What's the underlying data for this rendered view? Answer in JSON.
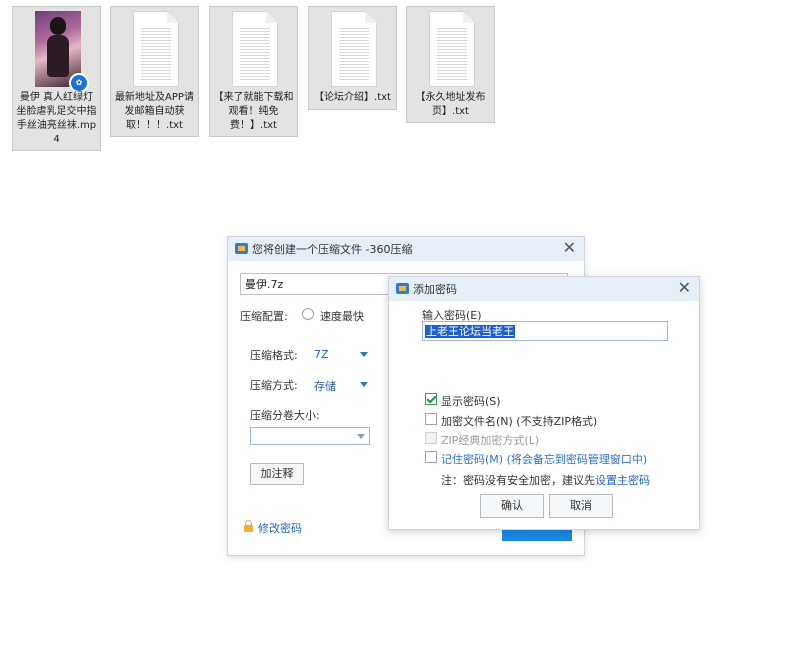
{
  "desktop": {
    "files": [
      {
        "name": "曼伊 真人红绿灯坐脸虐乳足交中指手丝油亮丝袜.mp4",
        "type": "video",
        "icon": "video-thumbnail"
      },
      {
        "name": "最新地址及APP请发邮箱自动获取！！！.txt",
        "type": "text",
        "icon": "text-file-icon"
      },
      {
        "name": "【来了就能下载和观看！纯免费！】.txt",
        "type": "text",
        "icon": "text-file-icon"
      },
      {
        "name": "【论坛介绍】.txt",
        "type": "text",
        "icon": "text-file-icon"
      },
      {
        "name": "【永久地址发布页】.txt",
        "type": "text",
        "icon": "text-file-icon"
      }
    ]
  },
  "create_dialog": {
    "title": "您将创建一个压缩文件 -360压缩",
    "filename": "曼伊.7z",
    "config_label": "压缩配置:",
    "config_option": "速度最快",
    "format_label": "压缩格式:",
    "format_value": "7Z",
    "method_label": "压缩方式:",
    "method_value": "存储",
    "split_label": "压缩分卷大小:",
    "split_value": "",
    "comment_button": "加注释",
    "change_password_link": "修改密码",
    "accent": "#1c88e6"
  },
  "password_dialog": {
    "title": "添加密码",
    "input_label": "输入密码(E)",
    "password": "上老王论坛当老王",
    "show_password": {
      "label": "显示密码(S)",
      "checked": true
    },
    "encrypt_names": {
      "label": "加密文件名(N) (不支持ZIP格式)",
      "checked": false
    },
    "zip_classic": {
      "label": "ZIP经典加密方式(L)",
      "checked": false,
      "disabled": true
    },
    "remember": {
      "label": "记住密码(M) (将会备忘到密码管理窗口中)",
      "checked": false
    },
    "note_prefix": "注：密码没有安全加密，建议先",
    "note_link": "设置主密码",
    "ok_button": "确认",
    "cancel_button": "取消"
  }
}
